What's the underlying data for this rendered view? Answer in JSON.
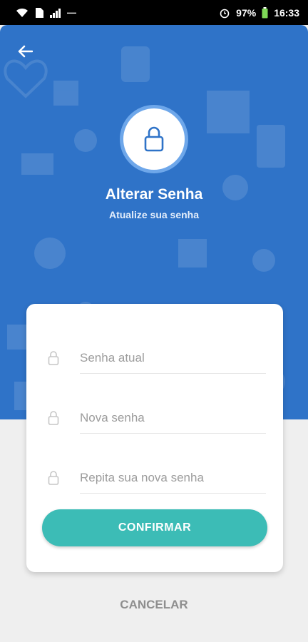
{
  "status_bar": {
    "battery": "97%",
    "time": "16:33"
  },
  "header": {
    "title": "Alterar Senha",
    "subtitle": "Atualize sua senha",
    "back_icon": "arrow-left-icon",
    "hero_icon": "lock-icon"
  },
  "form": {
    "current_password_placeholder": "Senha atual",
    "new_password_placeholder": "Nova senha",
    "repeat_password_placeholder": "Repita sua nova senha",
    "confirm_label": "CONFIRMAR",
    "cancel_label": "CANCELAR"
  },
  "colors": {
    "primary": "#2f73c8",
    "accent": "#3cbcb6",
    "background": "#efefef"
  }
}
